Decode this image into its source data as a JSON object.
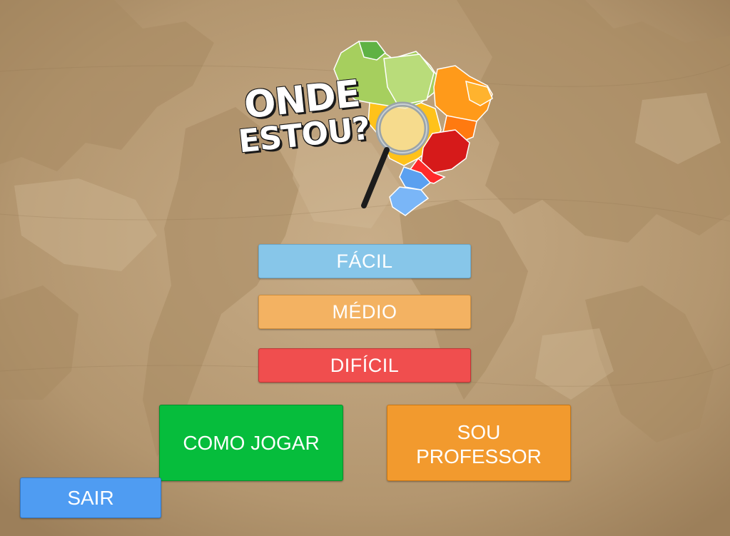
{
  "logo": {
    "line1": "ONDE",
    "line2": "ESTOU?"
  },
  "menu": {
    "easy_label": "FÁCIL",
    "medium_label": "MÉDIO",
    "hard_label": "DIFÍCIL",
    "how_to_play_label": "COMO JOGAR",
    "teacher_label": "SOU\nPROFESSOR",
    "exit_label": "SAIR"
  },
  "colors": {
    "easy": "#87c6e9",
    "medium": "#f3b262",
    "hard": "#f04e4e",
    "how_to_play": "#06bd3c",
    "teacher": "#f29a2e",
    "exit": "#4f9cf2",
    "background": "#b79a74"
  }
}
